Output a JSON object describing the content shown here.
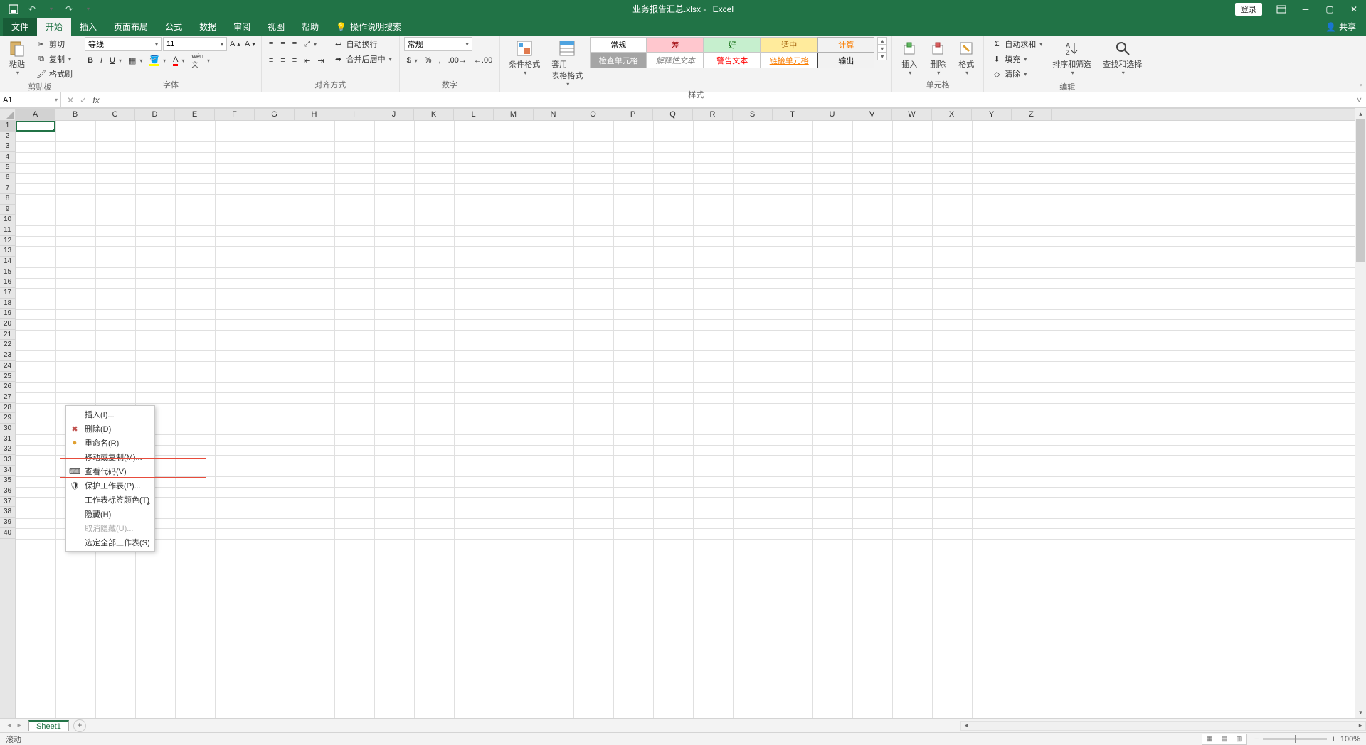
{
  "titlebar": {
    "filename": "业务报告汇总.xlsx",
    "app": "Excel",
    "login": "登录"
  },
  "tabs": {
    "file": "文件",
    "home": "开始",
    "insert": "插入",
    "layout": "页面布局",
    "formulas": "公式",
    "data": "数据",
    "review": "审阅",
    "view": "视图",
    "help": "帮助",
    "tell_me": "操作说明搜索",
    "share": "共享"
  },
  "ribbon": {
    "clipboard": {
      "label": "剪贴板",
      "paste": "粘贴",
      "cut": "剪切",
      "copy": "复制",
      "painter": "格式刷"
    },
    "font": {
      "label": "字体",
      "name": "等线",
      "size": "11"
    },
    "align": {
      "label": "对齐方式",
      "wrap": "自动换行",
      "merge": "合并后居中"
    },
    "number": {
      "label": "数字",
      "format": "常规"
    },
    "styles": {
      "label": "样式",
      "cond": "条件格式",
      "table": "套用\n表格格式",
      "cells": [
        "常规",
        "差",
        "好",
        "适中",
        "计算",
        "检查单元格",
        "解释性文本",
        "警告文本",
        "链接单元格",
        "输出"
      ]
    },
    "cells_grp": {
      "label": "单元格",
      "insert": "插入",
      "delete": "删除",
      "format": "格式"
    },
    "editing": {
      "label": "编辑",
      "autosum": "自动求和",
      "fill": "填充",
      "clear": "清除",
      "sort": "排序和筛选",
      "find": "查找和选择"
    }
  },
  "formula_bar": {
    "namebox": "A1"
  },
  "columns": [
    "A",
    "B",
    "C",
    "D",
    "E",
    "F",
    "G",
    "H",
    "I",
    "J",
    "K",
    "L",
    "M",
    "N",
    "O",
    "P",
    "Q",
    "R",
    "S",
    "T",
    "U",
    "V",
    "W",
    "X",
    "Y",
    "Z"
  ],
  "rows": [
    1,
    2,
    3,
    4,
    5,
    6,
    7,
    8,
    9,
    10,
    11,
    12,
    13,
    14,
    15,
    16,
    17,
    18,
    19,
    20,
    21,
    22,
    23,
    24,
    25,
    26,
    27,
    28,
    29,
    30,
    31,
    32,
    33,
    34,
    35,
    36,
    37,
    38,
    39,
    40
  ],
  "context_menu": {
    "insert": "插入(I)...",
    "delete": "删除(D)",
    "rename": "重命名(R)",
    "move": "移动或复制(M)...",
    "view_code": "查看代码(V)",
    "protect": "保护工作表(P)...",
    "tab_color": "工作表标签颜色(T)",
    "hide": "隐藏(H)",
    "unhide": "取消隐藏(U)...",
    "select_all": "选定全部工作表(S)"
  },
  "sheet": {
    "name": "Sheet1"
  },
  "statusbar": {
    "mode": "滚动",
    "zoom": "100%"
  }
}
